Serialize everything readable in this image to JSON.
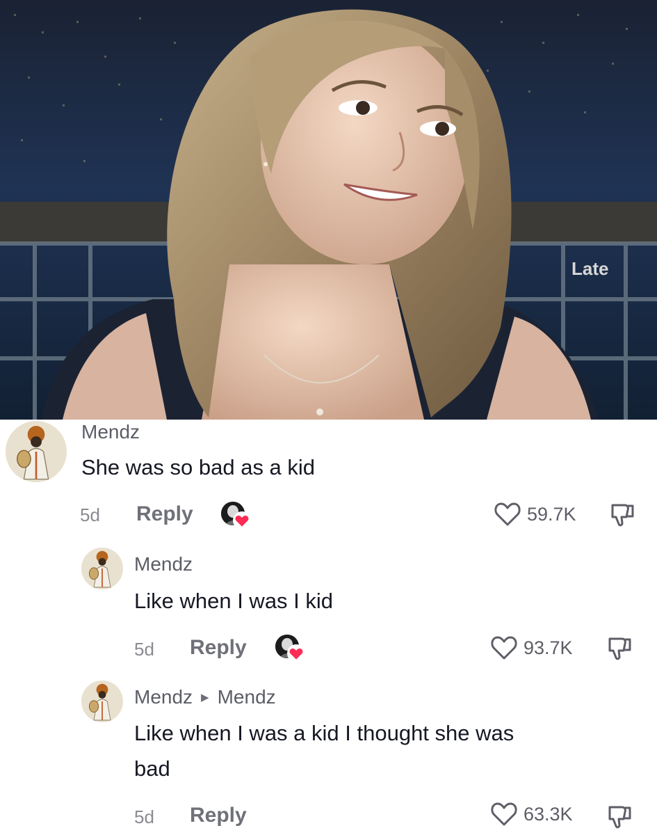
{
  "photo": {
    "sign_text": "Late",
    "icon": "photo"
  },
  "comments": [
    {
      "username": "Mendz",
      "text": "She was so bad as a kid",
      "age": "5d",
      "reply_label": "Reply",
      "likes": "59.7K"
    },
    {
      "username": "Mendz",
      "text": "Like when I was I kid",
      "age": "5d",
      "reply_label": "Reply",
      "likes": "93.7K"
    },
    {
      "username": "Mendz",
      "reply_to": "Mendz",
      "text_line1": "Like when I was a kid I thought she was",
      "text_line2": "bad",
      "age": "5d",
      "reply_label": "Reply",
      "likes": "63.3K"
    }
  ],
  "colors": {
    "heart_red": "#fe2c55",
    "text_primary": "#161823",
    "text_secondary": "#8a8b91"
  }
}
